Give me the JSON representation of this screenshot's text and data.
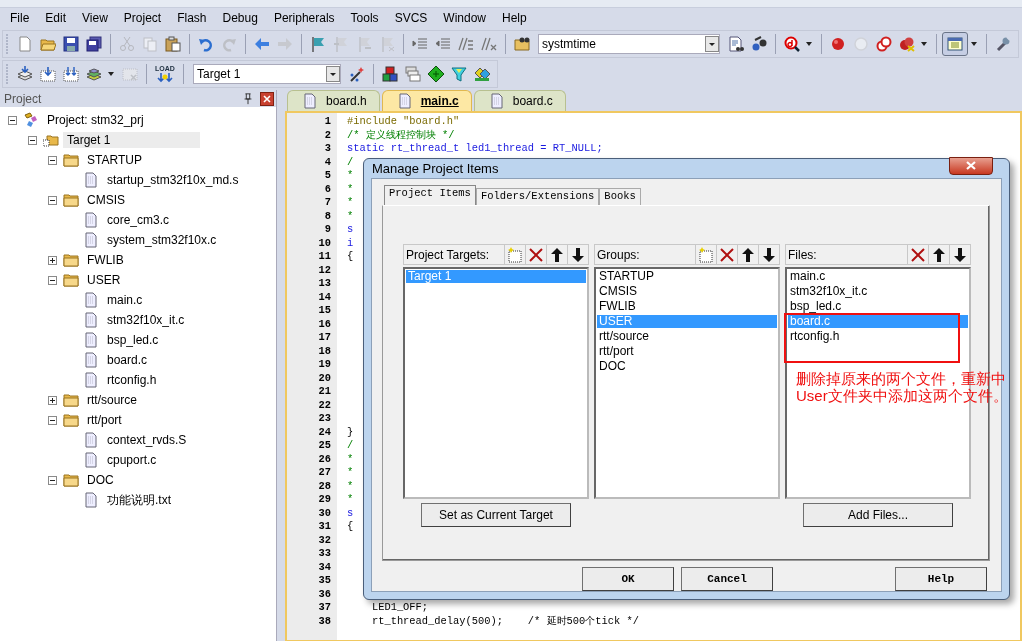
{
  "menu": [
    "File",
    "Edit",
    "View",
    "Project",
    "Flash",
    "Debug",
    "Peripherals",
    "Tools",
    "SVCS",
    "Window",
    "Help"
  ],
  "toolbar_1": [
    {
      "kind": "new",
      "disabled": false,
      "pressed": false
    },
    {
      "kind": "open",
      "disabled": false,
      "pressed": false
    },
    {
      "kind": "save",
      "disabled": false,
      "pressed": false
    },
    {
      "kind": "saveall",
      "disabled": false,
      "pressed": false
    },
    {
      "kind": "separator"
    },
    {
      "kind": "cut",
      "disabled": true,
      "pressed": false
    },
    {
      "kind": "copy",
      "disabled": true,
      "pressed": false
    },
    {
      "kind": "paste",
      "disabled": false,
      "pressed": false
    },
    {
      "kind": "separator"
    },
    {
      "kind": "undo",
      "disabled": false,
      "pressed": false
    },
    {
      "kind": "redo",
      "disabled": true,
      "pressed": false
    },
    {
      "kind": "separator"
    },
    {
      "kind": "back",
      "disabled": false,
      "pressed": false
    },
    {
      "kind": "forward",
      "disabled": true,
      "pressed": false
    },
    {
      "kind": "separator"
    },
    {
      "kind": "bookmark",
      "disabled": false,
      "pressed": false
    },
    {
      "kind": "prevmark",
      "disabled": true,
      "pressed": false
    },
    {
      "kind": "nextmark",
      "disabled": true,
      "pressed": false
    },
    {
      "kind": "clearmarks",
      "disabled": true,
      "pressed": false
    },
    {
      "kind": "separator"
    },
    {
      "kind": "indent",
      "disabled": false,
      "pressed": false
    },
    {
      "kind": "unindent",
      "disabled": false,
      "pressed": false
    },
    {
      "kind": "comment",
      "disabled": false,
      "pressed": false
    },
    {
      "kind": "uncomment",
      "disabled": false,
      "pressed": false
    },
    {
      "kind": "separator"
    },
    {
      "kind": "findopen",
      "disabled": false,
      "pressed": false
    },
    {
      "kind": "combo",
      "value": "systmtime"
    },
    {
      "kind": "findfiles",
      "disabled": false,
      "pressed": false
    },
    {
      "kind": "find",
      "disabled": false,
      "pressed": false
    },
    {
      "kind": "separator"
    },
    {
      "kind": "debug",
      "disabled": false,
      "pressed": false
    },
    {
      "kind": "caret"
    },
    {
      "kind": "separator"
    },
    {
      "kind": "breakpoint",
      "disabled": false,
      "pressed": false
    },
    {
      "kind": "bpdisable",
      "disabled": true,
      "pressed": false
    },
    {
      "kind": "bpall",
      "disabled": false,
      "pressed": false
    },
    {
      "kind": "bpkill",
      "disabled": false,
      "pressed": false
    },
    {
      "kind": "caret"
    },
    {
      "kind": "separator"
    },
    {
      "kind": "window",
      "disabled": false,
      "pressed": true
    },
    {
      "kind": "caret"
    },
    {
      "kind": "separator"
    },
    {
      "kind": "config",
      "disabled": false,
      "pressed": false
    }
  ],
  "toolbar_2": [
    {
      "kind": "translate",
      "disabled": false,
      "pressed": false
    },
    {
      "kind": "build",
      "disabled": false,
      "pressed": false
    },
    {
      "kind": "rebuild",
      "disabled": false,
      "pressed": false
    },
    {
      "kind": "batch",
      "disabled": false,
      "pressed": false
    },
    {
      "kind": "caret"
    },
    {
      "kind": "stop",
      "disabled": true,
      "pressed": false
    },
    {
      "kind": "separator"
    },
    {
      "kind": "load",
      "label": "LOAD",
      "disabled": false,
      "pressed": false
    },
    {
      "kind": "separator"
    },
    {
      "kind": "combo",
      "value": "Target 1"
    },
    {
      "kind": "wand",
      "disabled": false,
      "pressed": false
    },
    {
      "kind": "separator"
    },
    {
      "kind": "options",
      "disabled": false,
      "pressed": false
    },
    {
      "kind": "manage",
      "disabled": false,
      "pressed": false
    },
    {
      "kind": "diamond",
      "disabled": false,
      "pressed": false
    },
    {
      "kind": "funnel",
      "disabled": false,
      "pressed": false
    },
    {
      "kind": "packs",
      "disabled": false,
      "pressed": false
    }
  ],
  "project_panel": {
    "title": "Project",
    "tree": [
      {
        "label": "Project: stm32_prj",
        "kind": "project",
        "expanded": true,
        "selected": false,
        "children": [
          {
            "label": "Target 1",
            "kind": "target",
            "expanded": true,
            "selected": true,
            "children": [
              {
                "label": "STARTUP",
                "kind": "group",
                "expanded": true,
                "selected": false,
                "children": [
                  {
                    "label": "startup_stm32f10x_md.s",
                    "kind": "file",
                    "selected": false
                  }
                ]
              },
              {
                "label": "CMSIS",
                "kind": "group",
                "expanded": true,
                "selected": false,
                "children": [
                  {
                    "label": "core_cm3.c",
                    "kind": "file",
                    "selected": false
                  },
                  {
                    "label": "system_stm32f10x.c",
                    "kind": "file",
                    "selected": false
                  }
                ]
              },
              {
                "label": "FWLIB",
                "kind": "group",
                "expanded": false,
                "selected": false
              },
              {
                "label": "USER",
                "kind": "group",
                "expanded": true,
                "selected": false,
                "children": [
                  {
                    "label": "main.c",
                    "kind": "file",
                    "selected": false
                  },
                  {
                    "label": "stm32f10x_it.c",
                    "kind": "file",
                    "selected": false
                  },
                  {
                    "label": "bsp_led.c",
                    "kind": "file",
                    "selected": false
                  },
                  {
                    "label": "board.c",
                    "kind": "file",
                    "selected": false
                  },
                  {
                    "label": "rtconfig.h",
                    "kind": "file",
                    "selected": false
                  }
                ]
              },
              {
                "label": "rtt/source",
                "kind": "group",
                "expanded": false,
                "selected": false
              },
              {
                "label": "rtt/port",
                "kind": "group",
                "expanded": true,
                "selected": false,
                "children": [
                  {
                    "label": "context_rvds.S",
                    "kind": "file",
                    "selected": false
                  },
                  {
                    "label": "cpuport.c",
                    "kind": "file",
                    "selected": false
                  }
                ]
              },
              {
                "label": "DOC",
                "kind": "group",
                "expanded": true,
                "selected": false,
                "children": [
                  {
                    "label": "功能说明.txt",
                    "kind": "file",
                    "selected": false
                  }
                ]
              }
            ]
          }
        ]
      }
    ]
  },
  "editor": {
    "tabs": [
      {
        "label": "board.h",
        "selected": false
      },
      {
        "label": "main.c",
        "selected": true
      },
      {
        "label": "board.c",
        "selected": false
      }
    ],
    "lines": [
      {
        "number": "1",
        "text": "#include \"board.h\"",
        "kind": "directive"
      },
      {
        "number": "2",
        "text": "/* 定义线程控制块 */",
        "kind": "comment"
      },
      {
        "number": "3",
        "text": "static rt_thread_t led1_thread = RT_NULL;",
        "kind": "keyword"
      },
      {
        "number": "4",
        "text": "/",
        "kind": "comment"
      },
      {
        "number": "5",
        "text": "*",
        "kind": "comment"
      },
      {
        "number": "6",
        "text": "*",
        "kind": "comment"
      },
      {
        "number": "7",
        "text": "*",
        "kind": "comment"
      },
      {
        "number": "8",
        "text": "*",
        "kind": "comment"
      },
      {
        "number": "9",
        "text": "s",
        "kind": "keyword"
      },
      {
        "number": "10",
        "text": "i",
        "kind": "keyword"
      },
      {
        "number": "11",
        "text": "{",
        "kind": "code"
      },
      {
        "number": "12"
      },
      {
        "number": "13"
      },
      {
        "number": "14"
      },
      {
        "number": "15"
      },
      {
        "number": "16"
      },
      {
        "number": "17"
      },
      {
        "number": "18"
      },
      {
        "number": "19"
      },
      {
        "number": "20"
      },
      {
        "number": "21"
      },
      {
        "number": "22"
      },
      {
        "number": "23"
      },
      {
        "number": "24",
        "text": "}",
        "kind": "code"
      },
      {
        "number": "25",
        "text": "/",
        "kind": "comment"
      },
      {
        "number": "26",
        "text": "*",
        "kind": "comment"
      },
      {
        "number": "27",
        "text": "*",
        "kind": "comment"
      },
      {
        "number": "28",
        "text": "*",
        "kind": "comment"
      },
      {
        "number": "29",
        "text": "*",
        "kind": "comment"
      },
      {
        "number": "30",
        "text": "s",
        "kind": "keyword"
      },
      {
        "number": "31",
        "text": "{",
        "kind": "code"
      },
      {
        "number": "32"
      },
      {
        "number": "33"
      },
      {
        "number": "34"
      },
      {
        "number": "35"
      },
      {
        "number": "36"
      },
      {
        "number": "37",
        "text": "    LED1_OFF;",
        "kind": "code"
      },
      {
        "number": "38",
        "text": "    rt_thread_delay(500);    /* 延时500个tick */",
        "kind": "code"
      }
    ]
  },
  "dialog": {
    "title": "Manage Project Items",
    "tabs": [
      {
        "label": "Project Items",
        "selected": true
      },
      {
        "label": "Folders/Extensions",
        "selected": false
      },
      {
        "label": "Books",
        "selected": false
      }
    ],
    "panels": [
      {
        "title": "Project Targets:",
        "tools": [
          {
            "kind": "new"
          },
          {
            "kind": "delete"
          },
          {
            "kind": "up"
          },
          {
            "kind": "down"
          }
        ],
        "items": [
          {
            "label": "Target 1",
            "selected": true
          }
        ],
        "button": "Set as Current Target"
      },
      {
        "title": "Groups:",
        "tools": [
          {
            "kind": "new"
          },
          {
            "kind": "delete"
          },
          {
            "kind": "up"
          },
          {
            "kind": "down"
          }
        ],
        "items": [
          {
            "label": "STARTUP",
            "selected": false
          },
          {
            "label": "CMSIS",
            "selected": false
          },
          {
            "label": "FWLIB",
            "selected": false
          },
          {
            "label": "USER",
            "selected": true
          },
          {
            "label": "rtt/source",
            "selected": false
          },
          {
            "label": "rtt/port",
            "selected": false
          },
          {
            "label": "DOC",
            "selected": false
          }
        ]
      },
      {
        "title": "Files:",
        "tools": [
          {
            "kind": "delete"
          },
          {
            "kind": "up"
          },
          {
            "kind": "down"
          }
        ],
        "items": [
          {
            "label": "main.c",
            "selected": false
          },
          {
            "label": "stm32f10x_it.c",
            "selected": false
          },
          {
            "label": "bsp_led.c",
            "selected": false
          },
          {
            "label": "board.c",
            "selected": true
          },
          {
            "label": "rtconfig.h",
            "selected": false
          }
        ],
        "button": "Add Files..."
      }
    ],
    "buttons": [
      "OK",
      "Cancel",
      "Help"
    ]
  },
  "annotation": {
    "note": "删除掉原来的两个文件，重新中User文件夹中添加这两个文件。"
  }
}
